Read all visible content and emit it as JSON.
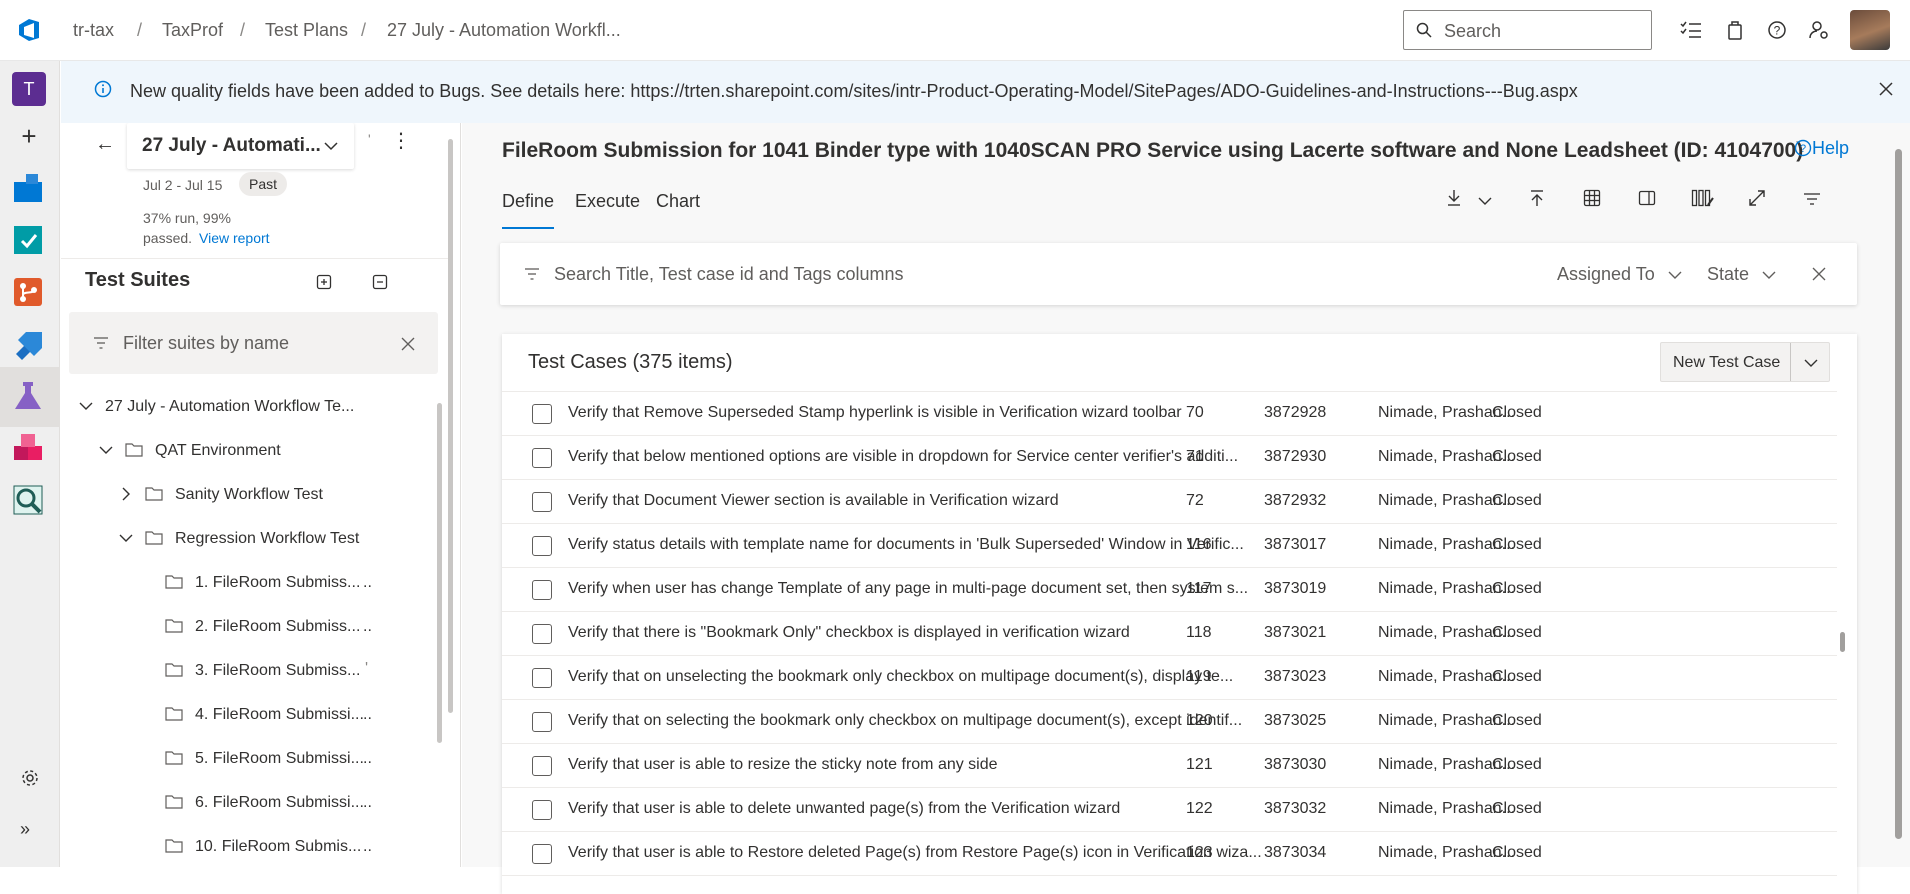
{
  "breadcrumb": [
    "tr-tax",
    "TaxProf",
    "Test Plans",
    "27 July - Automation Workfl..."
  ],
  "search": {
    "placeholder": "Search"
  },
  "banner": {
    "text": "New quality fields have been added to Bugs. See details here: https://trten.sharepoint.com/sites/intr-Product-Operating-Model/SitePages/ADO-Guidelines-and-Instructions---Bug.aspx"
  },
  "rail": {
    "avatar_letter": "T"
  },
  "plan": {
    "name": "27 July - Automati...",
    "dates": "Jul 2 - Jul 15",
    "badge": "Past",
    "stats_line1": "37% run, 99%",
    "stats_line2": "passed.",
    "view_report": "View report"
  },
  "suites": {
    "title": "Test Suites",
    "filter_placeholder": "Filter suites by name",
    "tree": [
      "27 July - Automation Workflow Te...",
      "QAT Environment",
      "Sanity Workflow Test",
      "Regression Workflow Test",
      "1. FileRoom Submiss...",
      "2. FileRoom Submiss...",
      "3. FileRoom Submiss...",
      "4. FileRoom Submissi...",
      "5. FileRoom Submissi...",
      "6. FileRoom Submissi...",
      "10. FileRoom Submis..."
    ]
  },
  "main": {
    "title": "FileRoom Submission for 1041 Binder type with 1040SCAN PRO Service using Lacerte software and None Leadsheet (ID: 4104700)",
    "help": "Help",
    "tabs": [
      "Define",
      "Execute",
      "Chart"
    ],
    "filter": {
      "placeholder": "Search Title, Test case id and Tags columns",
      "assigned_to": "Assigned To",
      "state": "State"
    },
    "cases": {
      "header": "Test Cases (375 items)",
      "new_button": "New Test Case",
      "rows": [
        {
          "title": "Verify that Remove Superseded Stamp hyperlink is visible in Verification wizard toolbar",
          "order": "70",
          "id": "3872928",
          "assigned": "Nimade, Prashan...",
          "state": "Closed"
        },
        {
          "title": "Verify that below mentioned options are visible in dropdown for Service center verifier's additi...",
          "order": "71",
          "id": "3872930",
          "assigned": "Nimade, Prashan...",
          "state": "Closed"
        },
        {
          "title": "Verify that Document Viewer section is available in Verification wizard",
          "order": "72",
          "id": "3872932",
          "assigned": "Nimade, Prashan...",
          "state": "Closed"
        },
        {
          "title": "Verify status details with template name for documents in 'Bulk Superseded' Window in Verific...",
          "order": "116",
          "id": "3873017",
          "assigned": "Nimade, Prashan...",
          "state": "Closed"
        },
        {
          "title": "Verify when user has change Template of any page in multi-page document set, then system s...",
          "order": "117",
          "id": "3873019",
          "assigned": "Nimade, Prashan...",
          "state": "Closed"
        },
        {
          "title": "Verify that there is \"Bookmark Only\" checkbox is displayed in verification wizard",
          "order": "118",
          "id": "3873021",
          "assigned": "Nimade, Prashan...",
          "state": "Closed"
        },
        {
          "title": "Verify that on unselecting the bookmark only checkbox on multipage document(s), display te...",
          "order": "119",
          "id": "3873023",
          "assigned": "Nimade, Prashan...",
          "state": "Closed"
        },
        {
          "title": "Verify that on selecting the bookmark only checkbox on multipage document(s), except identif...",
          "order": "120",
          "id": "3873025",
          "assigned": "Nimade, Prashan...",
          "state": "Closed"
        },
        {
          "title": "Verify that user is able to resize the sticky note from any side",
          "order": "121",
          "id": "3873030",
          "assigned": "Nimade, Prashan...",
          "state": "Closed"
        },
        {
          "title": "Verify that user is able to delete unwanted page(s) from the Verification wizard",
          "order": "122",
          "id": "3873032",
          "assigned": "Nimade, Prashan...",
          "state": "Closed"
        },
        {
          "title": "Verify that user is able to Restore deleted Page(s) from Restore Page(s) icon in Verification wiza...",
          "order": "123",
          "id": "3873034",
          "assigned": "Nimade, Prashan...",
          "state": "Closed"
        }
      ]
    }
  },
  "colors": {
    "accent": "#0078d4",
    "rail_bg": "#efefef",
    "banner_bg": "#eff6fc",
    "badge_bg": "#edebe9"
  }
}
